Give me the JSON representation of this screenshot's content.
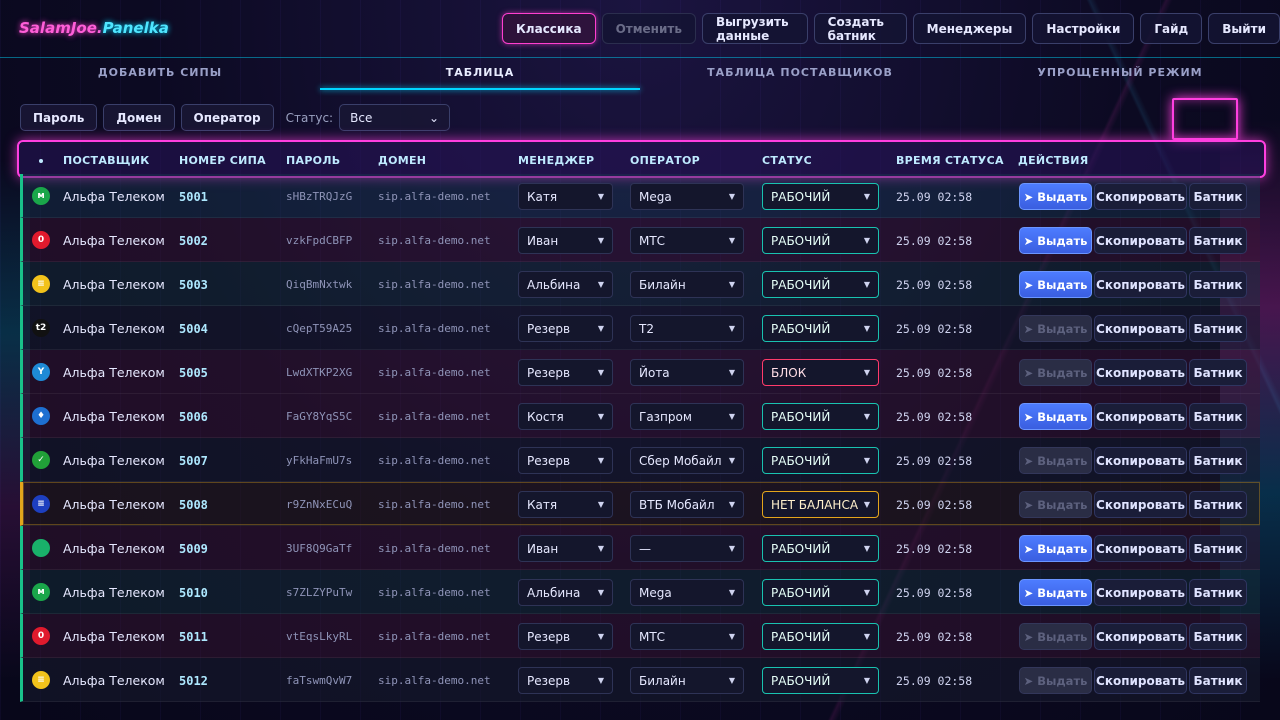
{
  "app": {
    "logo_main": "SalamJoe.",
    "logo_suffix": "Panelka"
  },
  "nav": [
    {
      "label": "Классика",
      "state": "active"
    },
    {
      "label": "Отменить",
      "state": "disabled"
    },
    {
      "label": "Выгрузить данные",
      "state": "normal"
    },
    {
      "label": "Создать батник",
      "state": "normal"
    },
    {
      "label": "Менеджеры",
      "state": "normal"
    },
    {
      "label": "Настройки",
      "state": "normal"
    },
    {
      "label": "Гайд",
      "state": "normal"
    },
    {
      "label": "Выйти",
      "state": "normal"
    }
  ],
  "tabs": [
    {
      "label": "ДОБАВИТЬ СИПЫ",
      "active": false
    },
    {
      "label": "ТАБЛИЦА",
      "active": true
    },
    {
      "label": "ТАБЛИЦА ПОСТАВЩИКОВ",
      "active": false
    },
    {
      "label": "УПРОЩЕННЫЙ РЕЖИМ",
      "active": false
    }
  ],
  "filters": {
    "password_label": "Пароль",
    "domain_label": "Домен",
    "operator_label": "Оператор",
    "status_label": "Статус:",
    "status_value": "Все"
  },
  "columns": {
    "supplier": "ПОСТАВЩИК",
    "sip_number": "НОМЕР СИПА",
    "password": "ПАРОЛЬ",
    "domain": "ДОМЕН",
    "manager": "МЕНЕДЖЕР",
    "operator": "ОПЕРАТОР",
    "status": "СТАТУС",
    "status_time": "ВРЕМЯ СТАТУСА",
    "actions": "ДЕЙСТВИЯ"
  },
  "actions": {
    "issue": "➤ Выдать",
    "copy": "Скопировать",
    "batch": "Батник"
  },
  "colors": {
    "accent_pink": "#ff3fe0",
    "accent_cyan": "#00d5ff",
    "status_ok": "#19c2b0",
    "status_block": "#ff3b6b",
    "status_warn": "#e3a51c",
    "issue_blue": "#4d7cff"
  },
  "rows": [
    {
      "icon": "megafon-icon",
      "icon_color": "#1aa64a",
      "icon_glyph": "м",
      "supplier": "Альфа Телеком",
      "sip": "5001",
      "password": "sHBzTRQJzG",
      "domain": "sip.alfa-demo.net",
      "manager": "Катя",
      "operator": "Mega",
      "status": "РАБОЧИЙ",
      "status_kind": "ok",
      "time": "25.09 02:58",
      "issue_enabled": true,
      "tint": "tint-0"
    },
    {
      "icon": "mts-icon",
      "icon_color": "#e01a2d",
      "icon_glyph": "0",
      "supplier": "Альфа Телеком",
      "sip": "5002",
      "password": "vzkFpdCBFP",
      "domain": "sip.alfa-demo.net",
      "manager": "Иван",
      "operator": "МТС",
      "status": "РАБОЧИЙ",
      "status_kind": "ok",
      "time": "25.09 02:58",
      "issue_enabled": true,
      "tint": "tint-1"
    },
    {
      "icon": "beeline-icon",
      "icon_color": "#f2c21b",
      "icon_glyph": "≡",
      "supplier": "Альфа Телеком",
      "sip": "5003",
      "password": "QiqBmNxtwk",
      "domain": "sip.alfa-demo.net",
      "manager": "Альбина",
      "operator": "Билайн",
      "status": "РАБОЧИЙ",
      "status_kind": "ok",
      "time": "25.09 02:58",
      "issue_enabled": true,
      "tint": "tint-2"
    },
    {
      "icon": "t2-icon",
      "icon_color": "#111111",
      "icon_glyph": "t2",
      "supplier": "Альфа Телеком",
      "sip": "5004",
      "password": "cQepT59A25",
      "domain": "sip.alfa-demo.net",
      "manager": "Резерв",
      "operator": "T2",
      "status": "РАБОЧИЙ",
      "status_kind": "ok",
      "time": "25.09 02:58",
      "issue_enabled": false,
      "tint": "tint-3"
    },
    {
      "icon": "yota-icon",
      "icon_color": "#1e8ad6",
      "icon_glyph": "Y",
      "supplier": "Альфа Телеком",
      "sip": "5005",
      "password": "LwdXTKP2XG",
      "domain": "sip.alfa-demo.net",
      "manager": "Резерв",
      "operator": "Йота",
      "status": "БЛОК",
      "status_kind": "blok",
      "time": "25.09 02:58",
      "issue_enabled": false,
      "tint": "tint-1"
    },
    {
      "icon": "gazprom-icon",
      "icon_color": "#1d6fd1",
      "icon_glyph": "♦",
      "supplier": "Альфа Телеком",
      "sip": "5006",
      "password": "FaGY8YqS5C",
      "domain": "sip.alfa-demo.net",
      "manager": "Костя",
      "operator": "Газпром",
      "status": "РАБОЧИЙ",
      "status_kind": "ok",
      "time": "25.09 02:58",
      "issue_enabled": true,
      "tint": "tint-1"
    },
    {
      "icon": "sber-icon",
      "icon_color": "#21a038",
      "icon_glyph": "✓",
      "supplier": "Альфа Телеком",
      "sip": "5007",
      "password": "yFkHaFmU7s",
      "domain": "sip.alfa-demo.net",
      "manager": "Резерв",
      "operator": "Сбер Мобайл",
      "status": "РАБОЧИЙ",
      "status_kind": "ok",
      "time": "25.09 02:58",
      "issue_enabled": false,
      "tint": "tint-3"
    },
    {
      "icon": "vtb-icon",
      "icon_color": "#1d3fbf",
      "icon_glyph": "≡",
      "supplier": "Альфа Телеком",
      "sip": "5008",
      "password": "r9ZnNxECuQ",
      "domain": "sip.alfa-demo.net",
      "manager": "Катя",
      "operator": "ВТБ Мобайл",
      "status": "НЕТ БАЛАНСА",
      "status_kind": "warn",
      "time": "25.09 02:58",
      "issue_enabled": false,
      "tint": "tint-warn"
    },
    {
      "icon": "generic-operator-icon",
      "icon_color": "#19b06a",
      "icon_glyph": "",
      "supplier": "Альфа Телеком",
      "sip": "5009",
      "password": "3UF8Q9GaTf",
      "domain": "sip.alfa-demo.net",
      "manager": "Иван",
      "operator": "—",
      "status": "РАБОЧИЙ",
      "status_kind": "ok",
      "time": "25.09 02:58",
      "issue_enabled": true,
      "tint": "tint-1"
    },
    {
      "icon": "megafon-icon",
      "icon_color": "#1aa64a",
      "icon_glyph": "м",
      "supplier": "Альфа Телеком",
      "sip": "5010",
      "password": "s7ZLZYPuTw",
      "domain": "sip.alfa-demo.net",
      "manager": "Альбина",
      "operator": "Mega",
      "status": "РАБОЧИЙ",
      "status_kind": "ok",
      "time": "25.09 02:58",
      "issue_enabled": true,
      "tint": "tint-2"
    },
    {
      "icon": "mts-icon",
      "icon_color": "#e01a2d",
      "icon_glyph": "0",
      "supplier": "Альфа Телеком",
      "sip": "5011",
      "password": "vtEqsLkyRL",
      "domain": "sip.alfa-demo.net",
      "manager": "Резерв",
      "operator": "МТС",
      "status": "РАБОЧИЙ",
      "status_kind": "ok",
      "time": "25.09 02:58",
      "issue_enabled": false,
      "tint": "tint-1"
    },
    {
      "icon": "beeline-icon",
      "icon_color": "#f2c21b",
      "icon_glyph": "≡",
      "supplier": "Альфа Телеком",
      "sip": "5012",
      "password": "faTswmQvW7",
      "domain": "sip.alfa-demo.net",
      "manager": "Резерв",
      "operator": "Билайн",
      "status": "РАБОЧИЙ",
      "status_kind": "ok",
      "time": "25.09 02:58",
      "issue_enabled": false,
      "tint": "tint-3"
    }
  ]
}
